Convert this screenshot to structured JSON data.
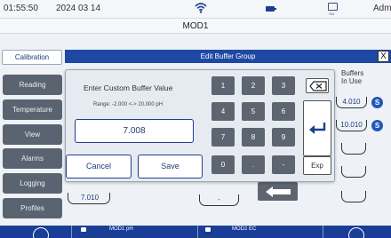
{
  "status": {
    "time": "01:55:50",
    "date": "2024 03 14",
    "usb_label": "ON",
    "user": "Admin"
  },
  "module_title": "MOD1",
  "sidebar": {
    "active_tab": "Calibration",
    "items": [
      "Reading",
      "Temperature",
      "View",
      "Alarms",
      "Logging",
      "Profiles"
    ]
  },
  "dialog_header": {
    "title": "Edit Buffer Group",
    "close_label": "X"
  },
  "buffers": {
    "header_line1": "Buffers",
    "header_line2": "In Use",
    "values": [
      "4.010",
      "10.010",
      "",
      "",
      "",
      ""
    ],
    "selected_badge": "S"
  },
  "bottom_left_value": "7.010",
  "bottom_mid_value": "-",
  "custom_dialog": {
    "title": "Enter Custom Buffer Value",
    "range": "Range: -2.000 <-> 20.000 pH",
    "value": "7.008",
    "cancel_label": "Cancel",
    "save_label": "Save"
  },
  "keypad": {
    "keys": [
      "1",
      "2",
      "3",
      "4",
      "5",
      "6",
      "7",
      "8",
      "9",
      "0",
      ".",
      "-"
    ],
    "exp_label": "Exp"
  },
  "bottom_bar": {
    "module1": "MOD1 pH",
    "module2": "MOD2 EC"
  },
  "colors": {
    "accent": "#1f48a5",
    "sidebar_button": "#5a6470",
    "keypad_key": "#5d6570"
  }
}
